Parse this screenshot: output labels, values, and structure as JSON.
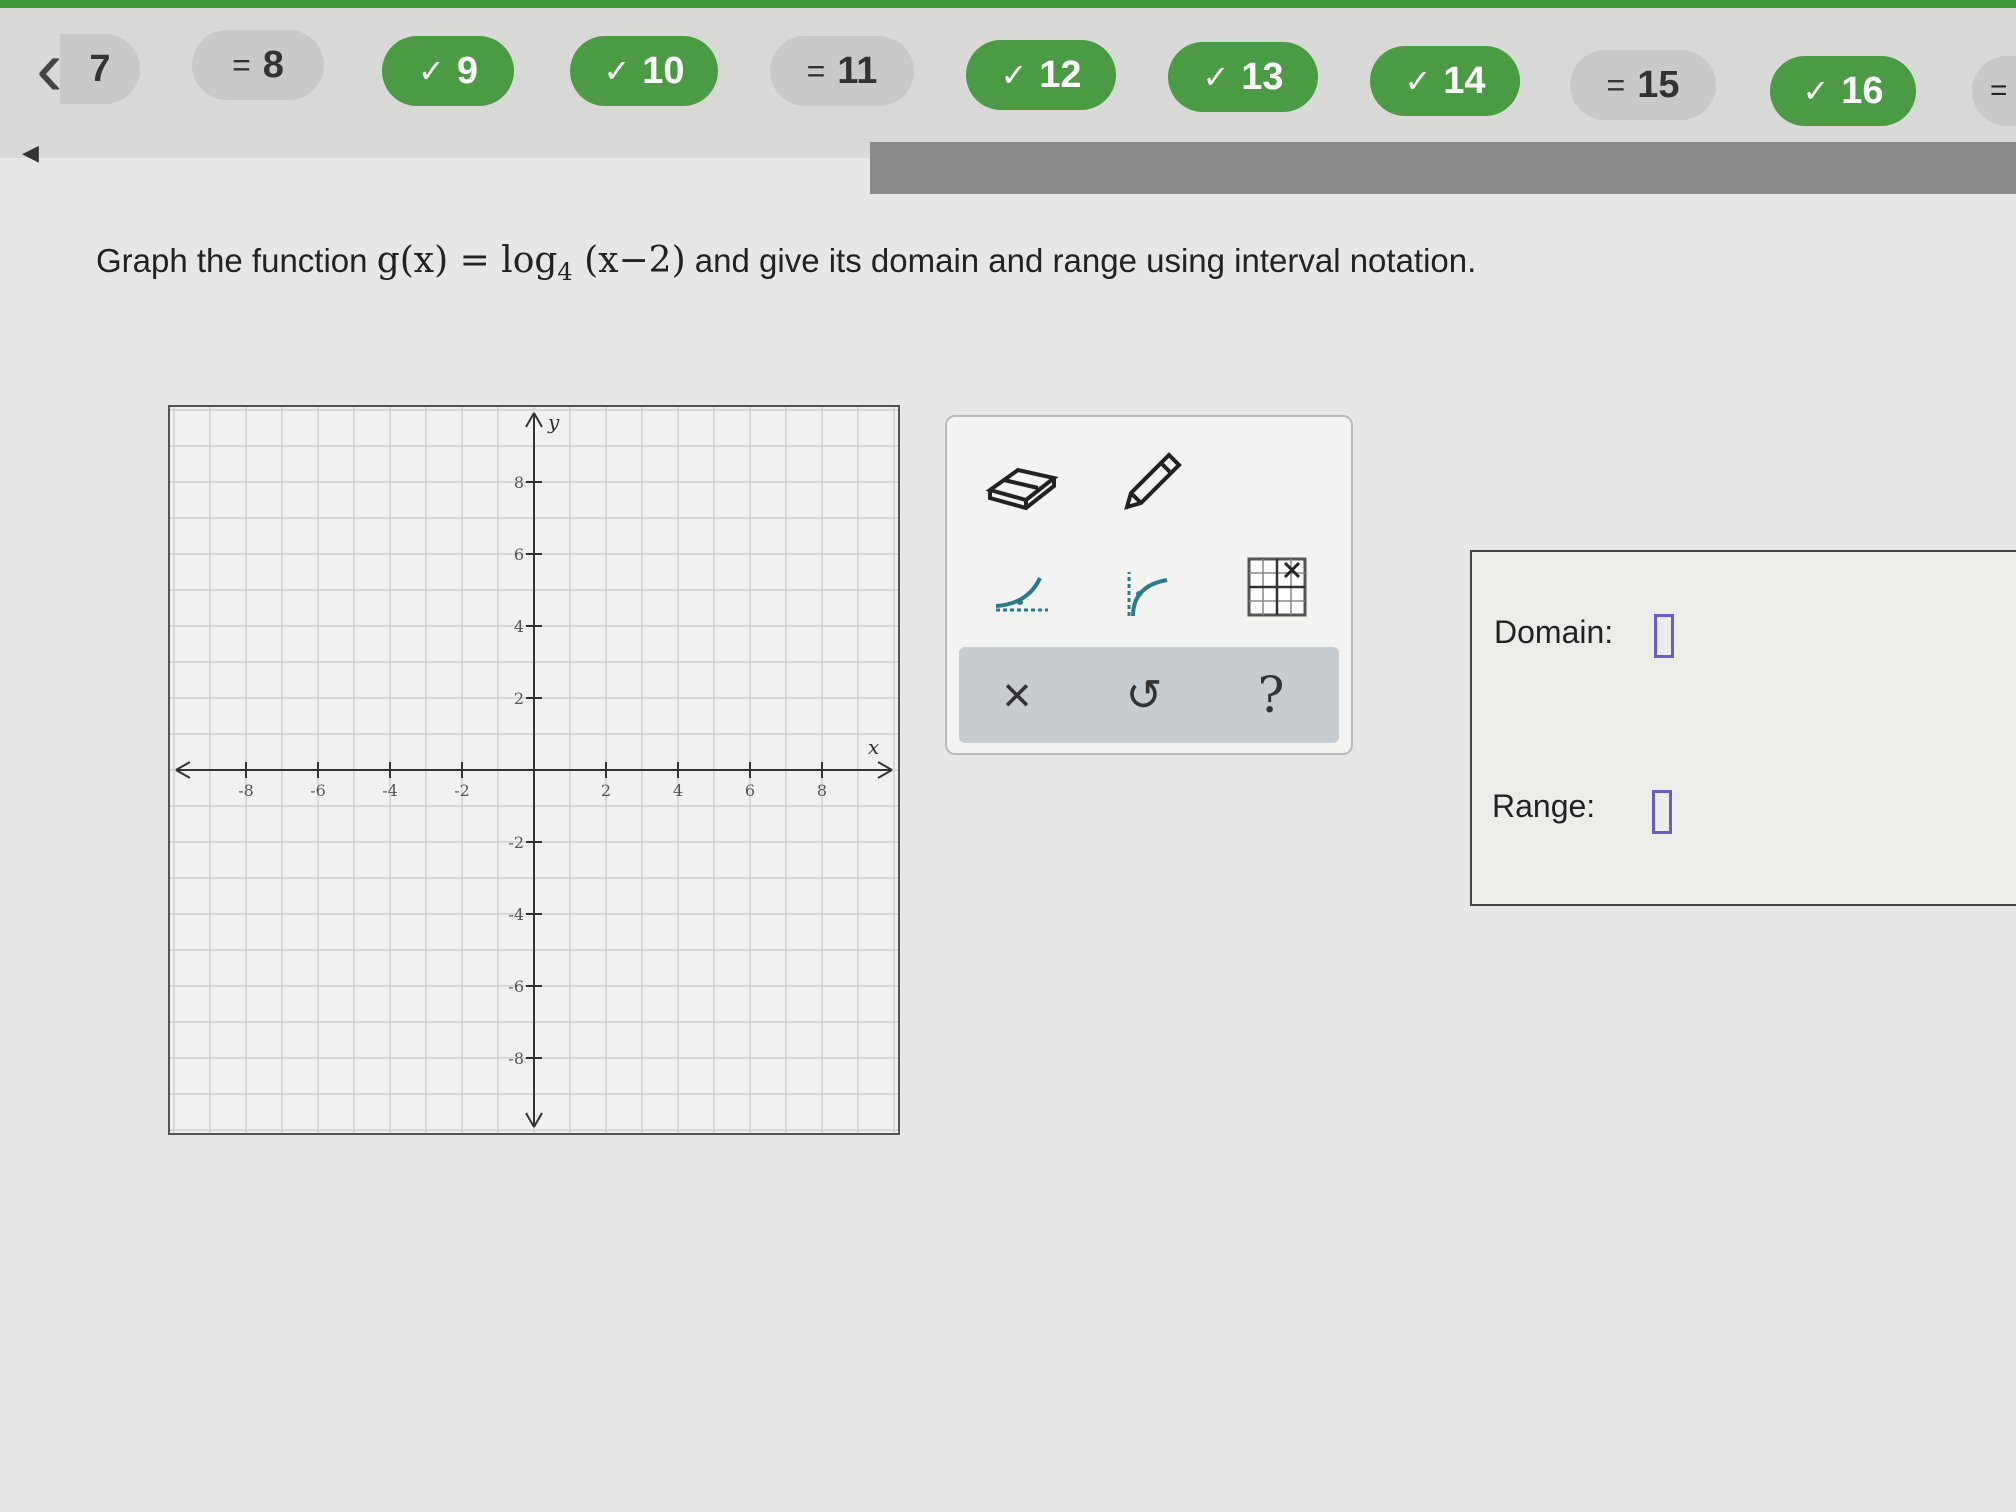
{
  "nav": {
    "back_label": "7",
    "items": [
      {
        "label": "8",
        "status": "review",
        "mark": "="
      },
      {
        "label": "9",
        "status": "done",
        "mark": "✓"
      },
      {
        "label": "10",
        "status": "done",
        "mark": "✓"
      },
      {
        "label": "11",
        "status": "review",
        "mark": "="
      },
      {
        "label": "12",
        "status": "done",
        "mark": "✓"
      },
      {
        "label": "13",
        "status": "done",
        "mark": "✓"
      },
      {
        "label": "14",
        "status": "done",
        "mark": "✓"
      },
      {
        "label": "15",
        "status": "review",
        "mark": "="
      },
      {
        "label": "16",
        "status": "done",
        "mark": "✓"
      }
    ],
    "overflow_mark": "="
  },
  "question": {
    "prefix": "Graph the function",
    "function_math": "g(x) = log",
    "base": "4",
    "argument": "(x−2)",
    "suffix": "and give its domain and range using interval notation."
  },
  "graph": {
    "x_axis_label": "x",
    "y_axis_label": "y",
    "x_ticks": [
      "-8",
      "-6",
      "-4",
      "-2",
      "2",
      "4",
      "6",
      "8"
    ],
    "y_ticks": [
      "8",
      "6",
      "4",
      "2",
      "-2",
      "-4",
      "-6",
      "-8"
    ]
  },
  "tools": {
    "eraser": "eraser-icon",
    "pencil": "pencil-icon",
    "exponential": "exponential-curve-icon",
    "logarithmic": "logarithmic-curve-icon",
    "no_solution": "no-solution-grid-icon",
    "clear_label": "×",
    "undo_label": "↺",
    "help_label": "?"
  },
  "answer": {
    "domain_label": "Domain:",
    "range_label": "Range:"
  },
  "colors": {
    "done_green": "#4b9a44",
    "review_gray": "#c9c9c7",
    "tool_teal": "#2a7c8c",
    "answer_box": "#6a5acd"
  }
}
